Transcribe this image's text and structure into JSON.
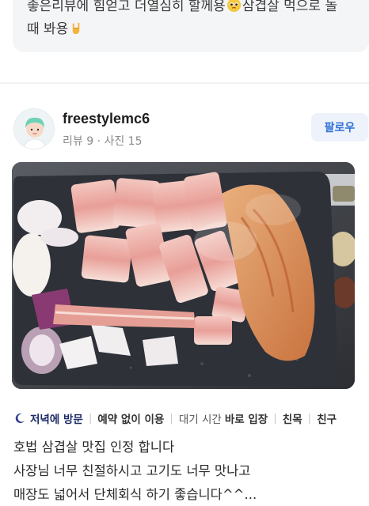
{
  "previous_review": {
    "line1": "좋은리뷰에 힘얻고 더열심히 할께용",
    "line1_tail": "삼겹살 먹으로 놀",
    "line2": "때 봐용"
  },
  "reviewer": {
    "username": "freestylemc6",
    "meta": "리뷰 9 · 사진 15",
    "follow_label": "팔로우"
  },
  "photo": {
    "subject": "grilled pork belly on grill"
  },
  "visit_tags": {
    "visit_time": "저녁에 방문",
    "reservation": "예약 없이 이용",
    "wait_label": "대기 시간",
    "wait_value": "바로 입장",
    "companion1": "친목",
    "companion2": "친구"
  },
  "review_text": {
    "line1": "호법 삼겹살 맛집 인정 합니다",
    "line2": "사장님 너무 친절하시고 고기도 너무 맛나고",
    "line3": "매장도 넓어서 단체회식 하기 좋습니다^^..."
  },
  "colors": {
    "accent": "#2f6fd6",
    "visit_tag": "#1d2a66",
    "card_bg": "#f4f5f7"
  }
}
